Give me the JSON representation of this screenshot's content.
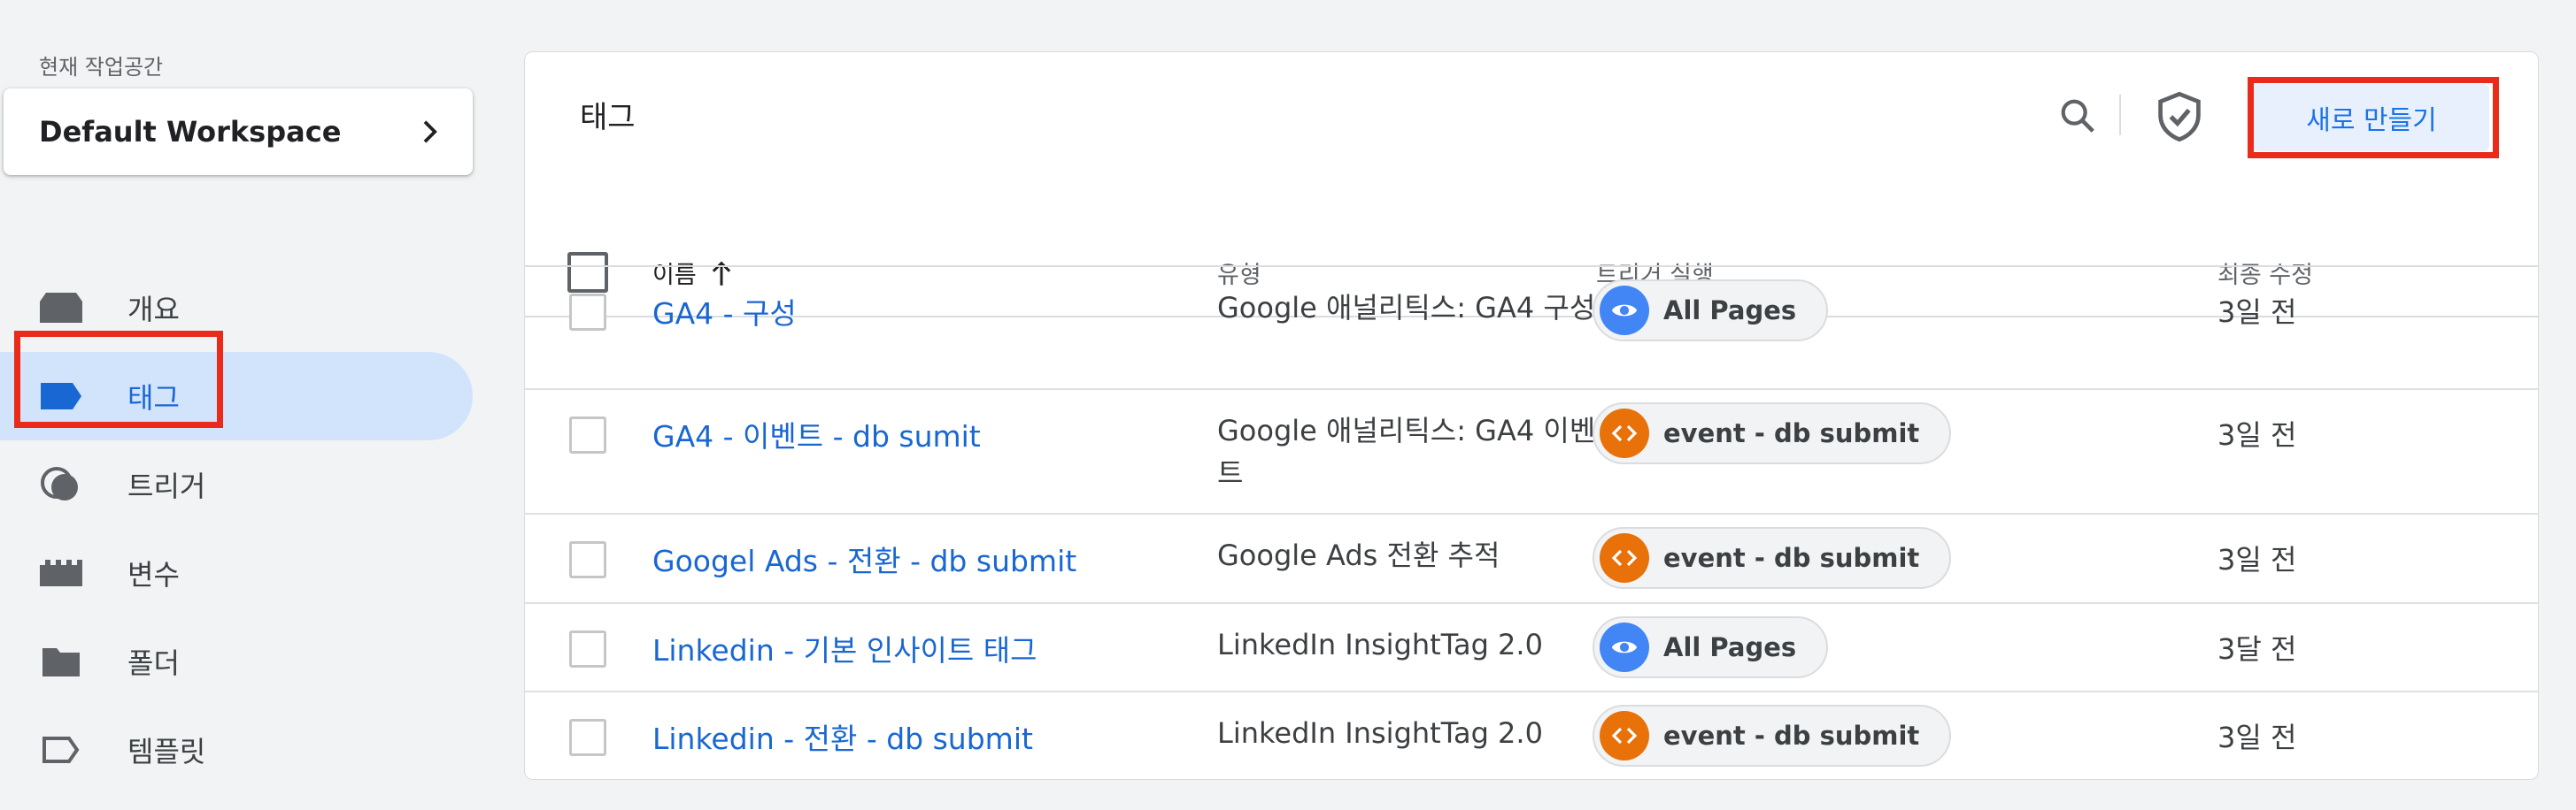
{
  "sidebar": {
    "workspace_label": "현재 작업공간",
    "workspace_name": "Default Workspace",
    "items": [
      {
        "label": "개요",
        "icon": "overview-icon"
      },
      {
        "label": "태그",
        "icon": "tag-icon"
      },
      {
        "label": "트리거",
        "icon": "trigger-icon"
      },
      {
        "label": "변수",
        "icon": "variable-icon"
      },
      {
        "label": "폴더",
        "icon": "folder-icon"
      },
      {
        "label": "템플릿",
        "icon": "template-icon"
      }
    ],
    "active_item": "태그"
  },
  "main": {
    "title": "태그",
    "new_button": "새로 만들기",
    "columns": {
      "name": "이름",
      "type": "유형",
      "trigger": "트리거 실행",
      "modified": "최종 수정"
    },
    "rows": [
      {
        "name": "GA4 - 구성",
        "type": "Google 애널리틱스: GA4 구성",
        "trigger": "All Pages",
        "trigger_kind": "pageview",
        "modified": "3일 전"
      },
      {
        "name": "GA4 - 이벤트 - db sumit",
        "type": "Google 애널리틱스: GA4 이벤트",
        "trigger": "event - db submit",
        "trigger_kind": "custom-event",
        "modified": "3일 전"
      },
      {
        "name": "Googel Ads - 전환 - db submit",
        "type": "Google Ads 전환 추적",
        "trigger": "event - db submit",
        "trigger_kind": "custom-event",
        "modified": "3일 전"
      },
      {
        "name": "Linkedin - 기본 인사이트 태그",
        "type": "LinkedIn InsightTag 2.0",
        "trigger": "All Pages",
        "trigger_kind": "pageview",
        "modified": "3달 전"
      },
      {
        "name": "Linkedin - 전환 - db submit",
        "type": "LinkedIn InsightTag 2.0",
        "trigger": "event - db submit",
        "trigger_kind": "custom-event",
        "modified": "3일 전"
      }
    ]
  },
  "colors": {
    "accent": "#1a73e8",
    "active_nav_bg": "#d2e3fc",
    "pageview_chip": "#4285f4",
    "event_chip": "#e8710a",
    "highlight": "#ea2a1a"
  }
}
